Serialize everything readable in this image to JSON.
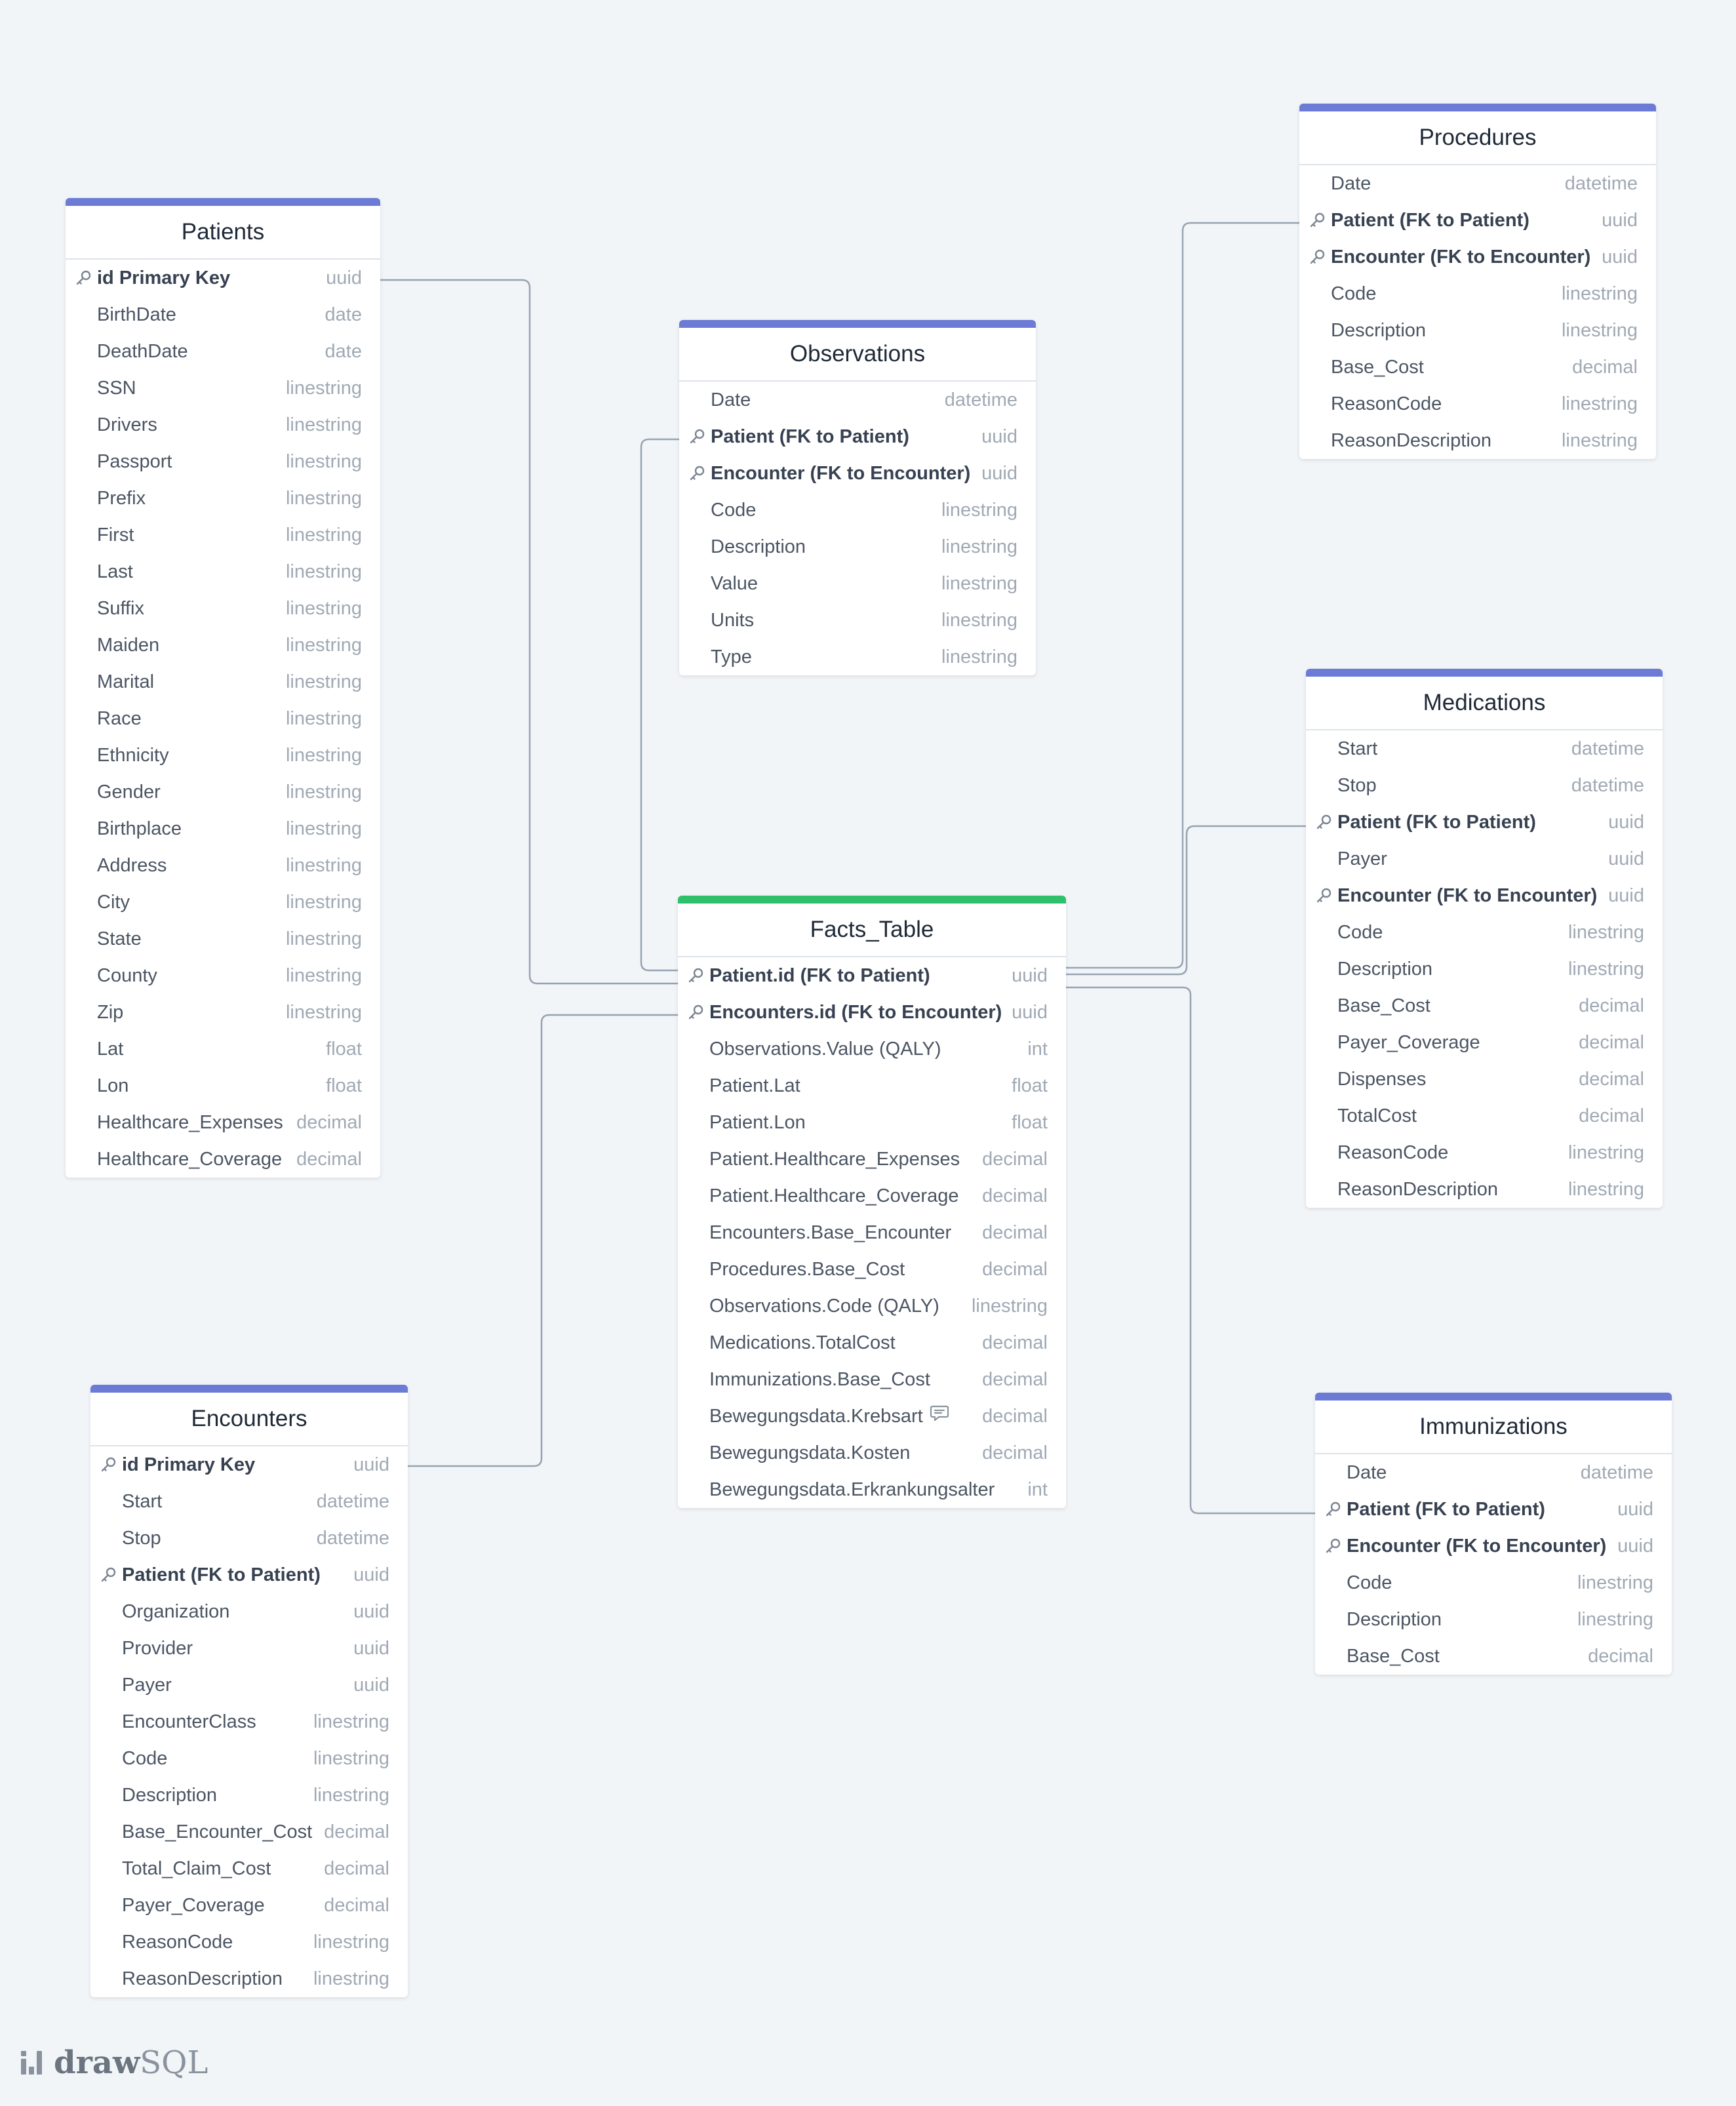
{
  "colors": {
    "background": "#f1f5f8",
    "table_accent": "#6b7bd6",
    "facts_accent": "#2ec06b",
    "connector": "#97a3b2"
  },
  "logo": {
    "text_bold": "draw",
    "text_light": "SQL"
  },
  "tables": [
    {
      "id": "patients",
      "name": "Patients",
      "fields": [
        {
          "name": "id Primary Key",
          "type": "uuid",
          "key": true
        },
        {
          "name": "BirthDate",
          "type": "date"
        },
        {
          "name": "DeathDate",
          "type": "date"
        },
        {
          "name": "SSN",
          "type": "linestring"
        },
        {
          "name": "Drivers",
          "type": "linestring"
        },
        {
          "name": "Passport",
          "type": "linestring"
        },
        {
          "name": "Prefix",
          "type": "linestring"
        },
        {
          "name": "First",
          "type": "linestring"
        },
        {
          "name": "Last",
          "type": "linestring"
        },
        {
          "name": "Suffix",
          "type": "linestring"
        },
        {
          "name": "Maiden",
          "type": "linestring"
        },
        {
          "name": "Marital",
          "type": "linestring"
        },
        {
          "name": "Race",
          "type": "linestring"
        },
        {
          "name": "Ethnicity",
          "type": "linestring"
        },
        {
          "name": "Gender",
          "type": "linestring"
        },
        {
          "name": "Birthplace",
          "type": "linestring"
        },
        {
          "name": "Address",
          "type": "linestring"
        },
        {
          "name": "City",
          "type": "linestring"
        },
        {
          "name": "State",
          "type": "linestring"
        },
        {
          "name": "County",
          "type": "linestring"
        },
        {
          "name": "Zip",
          "type": "linestring"
        },
        {
          "name": "Lat",
          "type": "float"
        },
        {
          "name": "Lon",
          "type": "float"
        },
        {
          "name": "Healthcare_Expenses",
          "type": "decimal"
        },
        {
          "name": "Healthcare_Coverage",
          "type": "decimal"
        }
      ]
    },
    {
      "id": "observations",
      "name": "Observations",
      "fields": [
        {
          "name": "Date",
          "type": "datetime"
        },
        {
          "name": "Patient (FK to Patient)",
          "type": "uuid",
          "key": true
        },
        {
          "name": "Encounter (FK to Encounter)",
          "type": "uuid",
          "key": true
        },
        {
          "name": "Code",
          "type": "linestring"
        },
        {
          "name": "Description",
          "type": "linestring"
        },
        {
          "name": "Value",
          "type": "linestring"
        },
        {
          "name": "Units",
          "type": "linestring"
        },
        {
          "name": "Type",
          "type": "linestring"
        }
      ]
    },
    {
      "id": "procedures",
      "name": "Procedures",
      "fields": [
        {
          "name": "Date",
          "type": "datetime"
        },
        {
          "name": "Patient (FK to Patient)",
          "type": "uuid",
          "key": true
        },
        {
          "name": "Encounter (FK to Encounter)",
          "type": "uuid",
          "key": true
        },
        {
          "name": "Code",
          "type": "linestring"
        },
        {
          "name": "Description",
          "type": "linestring"
        },
        {
          "name": "Base_Cost",
          "type": "decimal"
        },
        {
          "name": "ReasonCode",
          "type": "linestring"
        },
        {
          "name": "ReasonDescription",
          "type": "linestring"
        }
      ]
    },
    {
      "id": "medications",
      "name": "Medications",
      "fields": [
        {
          "name": "Start",
          "type": "datetime"
        },
        {
          "name": "Stop",
          "type": "datetime"
        },
        {
          "name": "Patient (FK to Patient)",
          "type": "uuid",
          "key": true
        },
        {
          "name": "Payer",
          "type": "uuid"
        },
        {
          "name": "Encounter (FK to Encounter)",
          "type": "uuid",
          "key": true
        },
        {
          "name": "Code",
          "type": "linestring"
        },
        {
          "name": "Description",
          "type": "linestring"
        },
        {
          "name": "Base_Cost",
          "type": "decimal"
        },
        {
          "name": "Payer_Coverage",
          "type": "decimal"
        },
        {
          "name": "Dispenses",
          "type": "decimal"
        },
        {
          "name": "TotalCost",
          "type": "decimal"
        },
        {
          "name": "ReasonCode",
          "type": "linestring"
        },
        {
          "name": "ReasonDescription",
          "type": "linestring"
        }
      ]
    },
    {
      "id": "facts",
      "name": "Facts_Table",
      "fields": [
        {
          "name": "Patient.id (FK to Patient)",
          "type": "uuid",
          "key": true
        },
        {
          "name": "Encounters.id (FK to Encounter)",
          "type": "uuid",
          "key": true
        },
        {
          "name": "Observations.Value (QALY)",
          "type": "int"
        },
        {
          "name": "Patient.Lat",
          "type": "float"
        },
        {
          "name": "Patient.Lon",
          "type": "float"
        },
        {
          "name": "Patient.Healthcare_Expenses",
          "type": "decimal"
        },
        {
          "name": "Patient.Healthcare_Coverage",
          "type": "decimal"
        },
        {
          "name": "Encounters.Base_Encounter",
          "type": "decimal"
        },
        {
          "name": "Procedures.Base_Cost",
          "type": "decimal"
        },
        {
          "name": "Observations.Code (QALY)",
          "type": "linestring"
        },
        {
          "name": "Medications.TotalCost",
          "type": "decimal"
        },
        {
          "name": "Immunizations.Base_Cost",
          "type": "decimal"
        },
        {
          "name": "Bewegungsdata.Krebsart",
          "type": "decimal",
          "comment": true
        },
        {
          "name": "Bewegungsdata.Kosten",
          "type": "decimal"
        },
        {
          "name": "Bewegungsdata.Erkrankungsalter",
          "type": "int"
        }
      ]
    },
    {
      "id": "encounters",
      "name": "Encounters",
      "fields": [
        {
          "name": "id Primary Key",
          "type": "uuid",
          "key": true
        },
        {
          "name": "Start",
          "type": "datetime"
        },
        {
          "name": "Stop",
          "type": "datetime"
        },
        {
          "name": "Patient (FK to Patient)",
          "type": "uuid",
          "key": true
        },
        {
          "name": "Organization",
          "type": "uuid"
        },
        {
          "name": "Provider",
          "type": "uuid"
        },
        {
          "name": "Payer",
          "type": "uuid"
        },
        {
          "name": "EncounterClass",
          "type": "linestring"
        },
        {
          "name": "Code",
          "type": "linestring"
        },
        {
          "name": "Description",
          "type": "linestring"
        },
        {
          "name": "Base_Encounter_Cost",
          "type": "decimal"
        },
        {
          "name": "Total_Claim_Cost",
          "type": "decimal"
        },
        {
          "name": "Payer_Coverage",
          "type": "decimal"
        },
        {
          "name": "ReasonCode",
          "type": "linestring"
        },
        {
          "name": "ReasonDescription",
          "type": "linestring"
        }
      ]
    },
    {
      "id": "immunizations",
      "name": "Immunizations",
      "fields": [
        {
          "name": "Date",
          "type": "datetime"
        },
        {
          "name": "Patient (FK to Patient)",
          "type": "uuid",
          "key": true
        },
        {
          "name": "Encounter (FK to Encounter)",
          "type": "uuid",
          "key": true
        },
        {
          "name": "Code",
          "type": "linestring"
        },
        {
          "name": "Description",
          "type": "linestring"
        },
        {
          "name": "Base_Cost",
          "type": "decimal"
        }
      ]
    }
  ]
}
